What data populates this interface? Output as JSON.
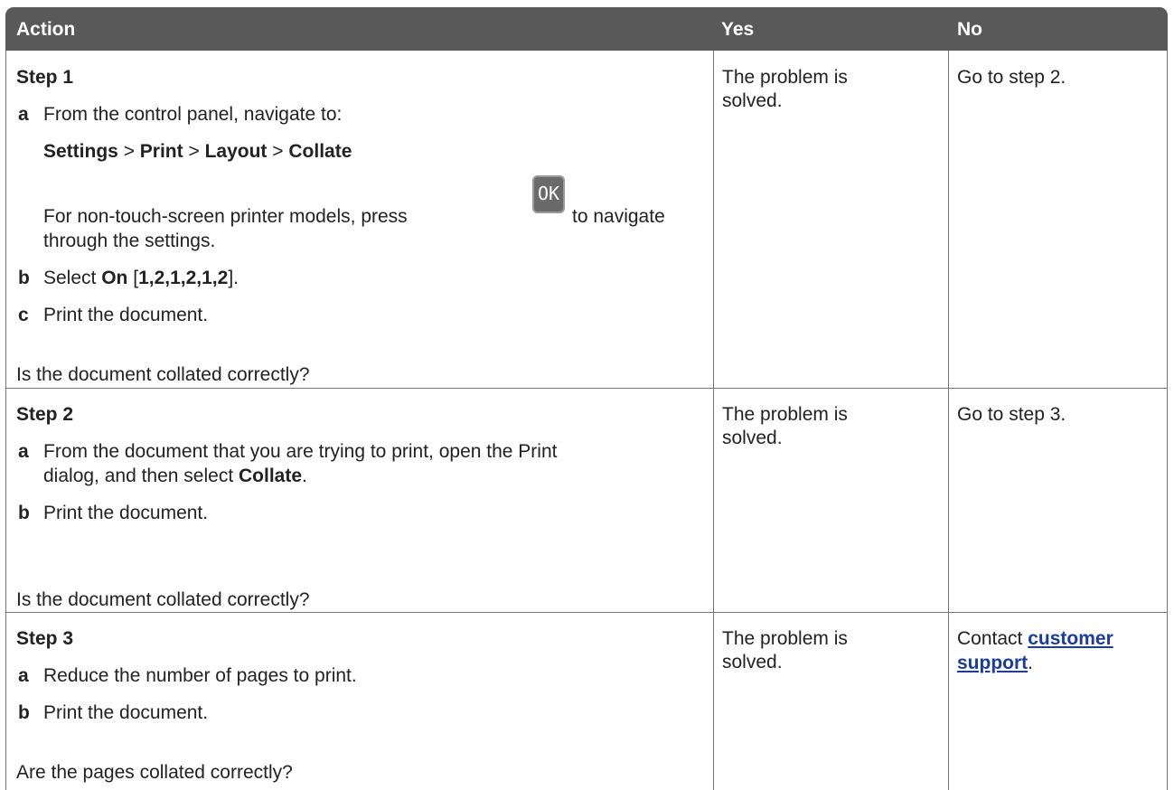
{
  "header": {
    "action": "Action",
    "yes": "Yes",
    "no": "No"
  },
  "steps": [
    {
      "title": "Step 1",
      "a_letter": "a",
      "a_text": "From the control panel, navigate to:",
      "path": [
        "Settings",
        ">",
        "Print",
        ">",
        "Layout",
        ">",
        "Collate"
      ],
      "note_before": "For non-touch-screen printer models, press",
      "ok_key": "OK",
      "note_after": "to navigate",
      "note_line2": "through the settings.",
      "b_letter": "b",
      "b_prefix": "Select",
      "b_bold": "On",
      "b_bracket_open": "[",
      "b_value": "1,2,1,2,1,2",
      "b_bracket_close": "].",
      "c_letter": "c",
      "c_text": "Print the document.",
      "question": "Is the document collated correctly?",
      "yes": "The problem is solved.",
      "no": "Go to step 2."
    },
    {
      "title": "Step 2",
      "a_letter": "a",
      "a_text_line1": "From the document that you are trying to print, open the Print",
      "a_text_line2_prefix": "dialog, and then select",
      "a_text_line2_bold": "Collate",
      "a_text_line2_suffix": ".",
      "b_letter": "b",
      "b_text": "Print the document.",
      "question": "Is the document collated correctly?",
      "yes": "The problem is solved.",
      "no": "Go to step 3."
    },
    {
      "title": "Step 3",
      "a_letter": "a",
      "a_text": "Reduce the number of pages to print.",
      "b_letter": "b",
      "b_text": "Print the document.",
      "question": "Are the pages collated correctly?",
      "yes": "The problem is solved.",
      "no_prefix": "Contact",
      "no_link_line1": "customer",
      "no_link_line2": "support",
      "no_suffix": "."
    }
  ]
}
